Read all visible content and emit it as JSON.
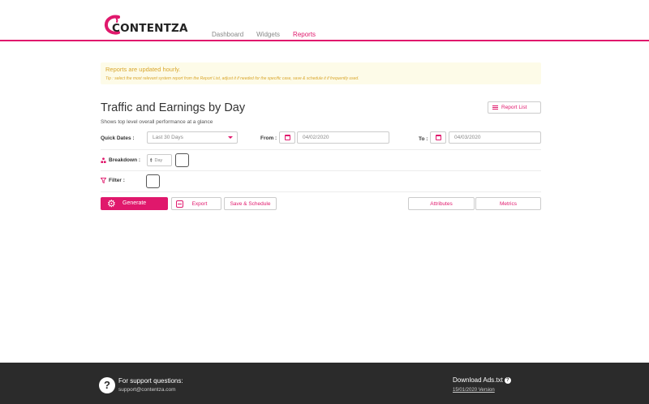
{
  "brand": {
    "name": "CONTENTZA",
    "accent": "#e0186c"
  },
  "nav": {
    "items": [
      {
        "label": "Dashboard"
      },
      {
        "label": "Widgets"
      },
      {
        "label": "Reports"
      }
    ],
    "active": "Reports"
  },
  "notice": {
    "title": "Reports are updated hourly.",
    "tip": "Tip : select the most relevant system report from the Report List, adjust it if needed for the specific case, save & schedule it if frequently used."
  },
  "report": {
    "title": "Traffic and Earnings by Day",
    "subtitle": "Shows top level overall performance at a glance",
    "report_list_label": "Report List"
  },
  "form": {
    "quick_dates_label": "Quick Dates :",
    "quick_dates_value": "Last 30 Days",
    "from_label": "From :",
    "from_value": "04/02/2020",
    "to_label": "To :",
    "to_value": "04/03/2020",
    "breakdown_label": "Breakdown :",
    "breakdown_value": "Day",
    "filter_label": "Filter :"
  },
  "actions": {
    "generate": "Generate",
    "export": "Export",
    "save_schedule": "Save & Schedule",
    "attributes": "Attributes",
    "metrics": "Metrics"
  },
  "footer": {
    "support_title": "For support questions:",
    "support_email": "support@contentza.com",
    "ads_title": "Download Ads.txt",
    "version": "15/01/2020 Version"
  }
}
